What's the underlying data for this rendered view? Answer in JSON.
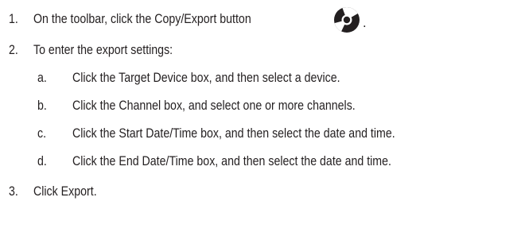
{
  "steps": [
    {
      "number": "1.",
      "text": "On the toolbar, click the Copy/Export button",
      "icon": "copy-export-disc-icon",
      "after_icon": "."
    },
    {
      "number": "2.",
      "text": "To enter the export settings:",
      "substeps": [
        {
          "letter": "a.",
          "text": "Click the Target Device box, and then select a device."
        },
        {
          "letter": "b.",
          "text": "Click the Channel box, and select one or more channels."
        },
        {
          "letter": "c.",
          "text": "Click the Start Date/Time box, and then select the date and time."
        },
        {
          "letter": "d.",
          "text": "Click the End Date/Time box, and then select the date and time."
        }
      ]
    },
    {
      "number": "3.",
      "text": "Click Export."
    }
  ],
  "colors": {
    "text": "#231f20",
    "icon_fill": "#231f20"
  }
}
